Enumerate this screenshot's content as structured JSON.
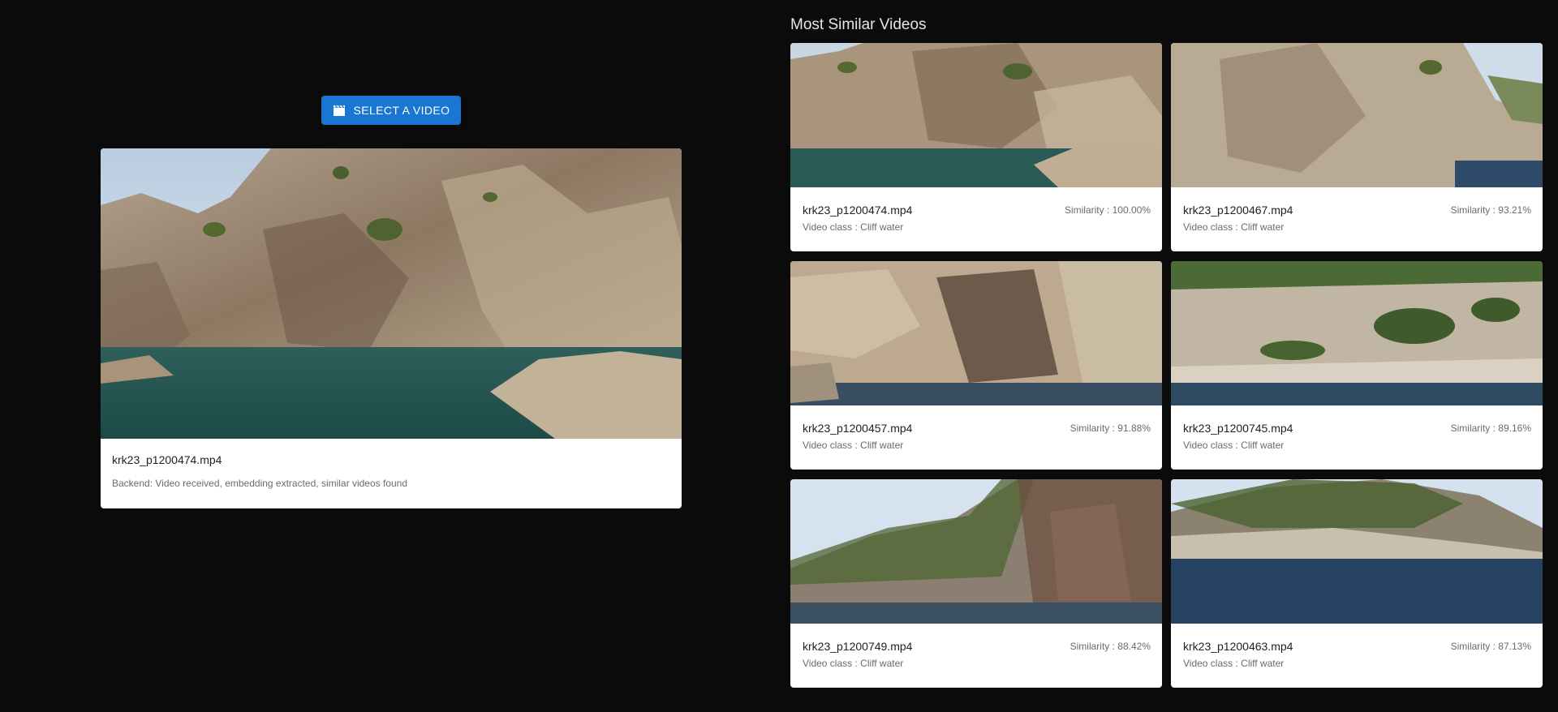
{
  "controls": {
    "select_label": "SELECT A VIDEO",
    "select_icon": "clapperboard-icon"
  },
  "selected": {
    "filename": "krk23_p1200474.mp4",
    "status": "Backend: Video received, embedding extracted, similar videos found"
  },
  "similar": {
    "title": "Most Similar Videos",
    "items": [
      {
        "filename": "krk23_p1200474.mp4",
        "similarity": "Similarity : 100.00%",
        "video_class": "Video class : Cliff water"
      },
      {
        "filename": "krk23_p1200467.mp4",
        "similarity": "Similarity : 93.21%",
        "video_class": "Video class : Cliff water"
      },
      {
        "filename": "krk23_p1200457.mp4",
        "similarity": "Similarity : 91.88%",
        "video_class": "Video class : Cliff water"
      },
      {
        "filename": "krk23_p1200745.mp4",
        "similarity": "Similarity : 89.16%",
        "video_class": "Video class : Cliff water"
      },
      {
        "filename": "krk23_p1200749.mp4",
        "similarity": "Similarity : 88.42%",
        "video_class": "Video class : Cliff water"
      },
      {
        "filename": "krk23_p1200463.mp4",
        "similarity": "Similarity : 87.13%",
        "video_class": "Video class : Cliff water"
      }
    ]
  },
  "colors": {
    "background": "#0b0b0b",
    "accent": "#1976d2",
    "card": "#ffffff",
    "muted_text": "#6b6b6b"
  }
}
